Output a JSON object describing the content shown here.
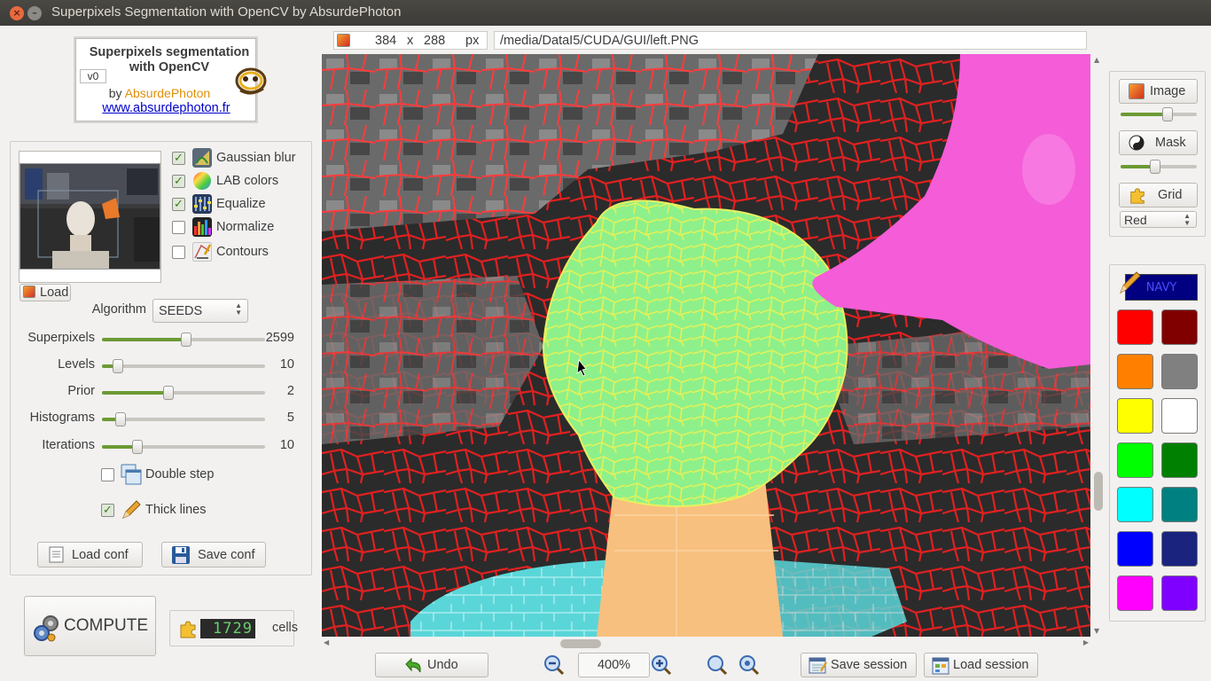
{
  "window": {
    "title": "Superpixels Segmentation with OpenCV by AbsurdePhoton"
  },
  "logo": {
    "title_line1": "Superpixels segmentation",
    "title_line2": "with OpenCV",
    "version": "v0",
    "by": "by",
    "author": "AbsurdePhoton",
    "url": "www.absurdephoton.fr"
  },
  "options": {
    "gaussian_blur": {
      "label": "Gaussian blur",
      "checked": true
    },
    "lab_colors": {
      "label": "LAB colors",
      "checked": true
    },
    "equalize": {
      "label": "Equalize",
      "checked": true
    },
    "normalize": {
      "label": "Normalize",
      "checked": false
    },
    "contours": {
      "label": "Contours",
      "checked": false
    }
  },
  "load_button": "Load",
  "algorithm": {
    "label": "Algorithm",
    "value": "SEEDS"
  },
  "sliders": {
    "superpixels": {
      "label": "Superpixels",
      "value": "2599",
      "fraction": 0.52
    },
    "levels": {
      "label": "Levels",
      "value": "10",
      "fraction": 0.07
    },
    "prior": {
      "label": "Prior",
      "value": "2",
      "fraction": 0.4
    },
    "histograms": {
      "label": "Histograms",
      "value": "5",
      "fraction": 0.09
    },
    "iterations": {
      "label": "Iterations",
      "value": "10",
      "fraction": 0.2
    }
  },
  "double_step": {
    "label": "Double step",
    "checked": false
  },
  "thick_lines": {
    "label": "Thick lines",
    "checked": true
  },
  "load_conf": "Load conf",
  "save_conf": "Save conf",
  "compute_button": "COMPUTE",
  "cells": {
    "count": "1729",
    "label": "cells"
  },
  "image_info": {
    "width": "384",
    "x": "x",
    "height": "288",
    "unit": "px",
    "path": "/media/DataI5/CUDA/GUI/left.PNG"
  },
  "right": {
    "image_button": "Image",
    "image_opacity": 0.63,
    "mask_button": "Mask",
    "mask_opacity": 0.44,
    "grid_button": "Grid",
    "grid_color": "Red",
    "pen_color_label": "NAVY",
    "palette": [
      "#ff0000",
      "#800000",
      "#ff8000",
      "#808080",
      "#ffff00",
      "#ffffff",
      "#00ff00",
      "#008000",
      "#00ffff",
      "#008080",
      "#0000ff",
      "#1a237e",
      "#ff00ff",
      "#8000ff"
    ]
  },
  "bottom": {
    "undo": "Undo",
    "zoom": "400%",
    "save_session": "Save session",
    "load_session": "Load session"
  }
}
